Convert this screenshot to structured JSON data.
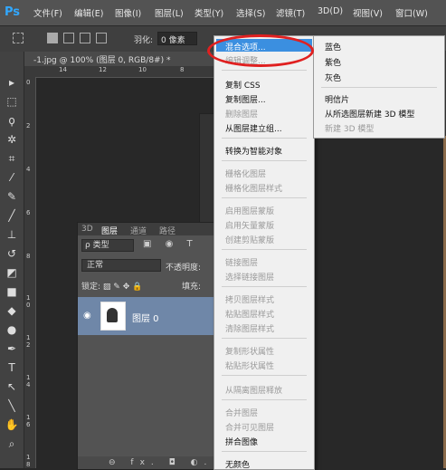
{
  "menubar": {
    "logo": "Ps",
    "items": [
      "文件(F)",
      "编辑(E)",
      "图像(I)",
      "图层(L)",
      "类型(Y)",
      "选择(S)",
      "滤镜(T)",
      "3D(D)",
      "视图(V)",
      "窗口(W)"
    ]
  },
  "options": {
    "feather_label": "羽化:",
    "feather_value": "0 像素"
  },
  "document": {
    "tab_title": "-1.jpg @ 100% (图层 0, RGB/8#) *",
    "ruler_top": [
      "14",
      "12",
      "10",
      "8"
    ],
    "ruler_left": [
      "0",
      "2",
      "4",
      "6",
      "8",
      "1 0",
      "1 2",
      "1 4",
      "1 6",
      "1 8"
    ]
  },
  "layers_panel": {
    "tabs": [
      "3D",
      "图层",
      "通道",
      "路径"
    ],
    "filter_label": "ρ 类型",
    "filter_icons": "▣ ◉ T",
    "blend_mode": "正常",
    "opacity_label": "不透明度:",
    "lock_label": "锁定:",
    "lock_icons": "▨ ✎ ✥ 🔒",
    "fill_label": "填充:",
    "layer_name": "图层 0",
    "footer_icons": "⊖ fx. ◘ ◐. ■"
  },
  "context_menu": {
    "items": [
      {
        "label": "混合选项...",
        "state": "highlighted"
      },
      {
        "label": "编辑调整...",
        "state": "disabled"
      },
      {
        "label": "复制 CSS",
        "state": "enabled"
      },
      {
        "label": "复制图层...",
        "state": "enabled"
      },
      {
        "label": "删除图层",
        "state": "disabled"
      },
      {
        "label": "从图层建立组...",
        "state": "enabled"
      },
      {
        "label": "转换为智能对象",
        "state": "enabled"
      },
      {
        "label": "栅格化图层",
        "state": "disabled"
      },
      {
        "label": "栅格化图层样式",
        "state": "disabled"
      },
      {
        "label": "启用图层蒙版",
        "state": "disabled"
      },
      {
        "label": "启用矢量蒙版",
        "state": "disabled"
      },
      {
        "label": "创建剪贴蒙版",
        "state": "disabled"
      },
      {
        "label": "链接图层",
        "state": "disabled"
      },
      {
        "label": "选择链接图层",
        "state": "disabled"
      },
      {
        "label": "拷贝图层样式",
        "state": "disabled"
      },
      {
        "label": "粘贴图层样式",
        "state": "disabled"
      },
      {
        "label": "清除图层样式",
        "state": "disabled"
      },
      {
        "label": "复制形状属性",
        "state": "disabled"
      },
      {
        "label": "粘贴形状属性",
        "state": "disabled"
      },
      {
        "label": "从隔离图层释放",
        "state": "disabled"
      },
      {
        "label": "合并图层",
        "state": "disabled"
      },
      {
        "label": "合并可见图层",
        "state": "disabled"
      },
      {
        "label": "拼合图像",
        "state": "enabled"
      },
      {
        "label": "无颜色",
        "state": "enabled"
      }
    ]
  },
  "submenu": {
    "items": [
      {
        "label": "蓝色",
        "state": "enabled"
      },
      {
        "label": "紫色",
        "state": "enabled"
      },
      {
        "label": "灰色",
        "state": "enabled"
      },
      {
        "label": "明信片",
        "state": "enabled"
      },
      {
        "label": "从所选图层新建 3D 模型",
        "state": "enabled"
      },
      {
        "label": "新建 3D 模型",
        "state": "disabled"
      }
    ]
  },
  "colors": {
    "highlight": "#3b8fe0",
    "annotation_ring": "#e02020",
    "selected_layer": "#6f87a8"
  }
}
